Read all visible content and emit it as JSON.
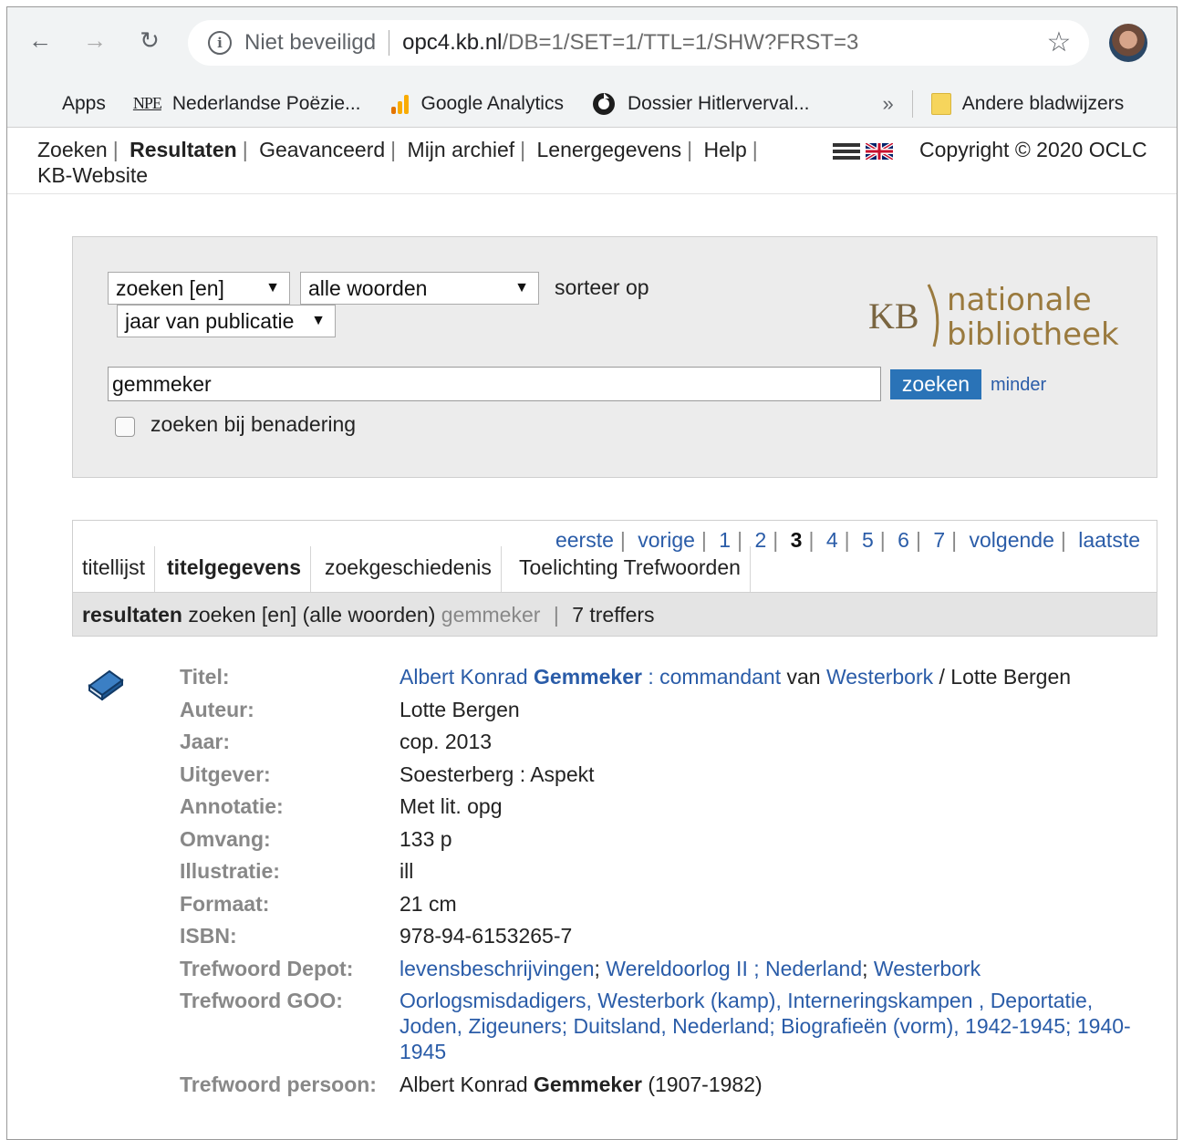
{
  "browser": {
    "security_label": "Niet beveiligd",
    "url_host": "opc4.kb.nl",
    "url_path": "/DB=1/SET=1/TTL=1/SHW?FRST=3",
    "bookmarks": [
      {
        "label": "Apps"
      },
      {
        "label": "Nederlandse Poëzie..."
      },
      {
        "label": "Google Analytics"
      },
      {
        "label": "Dossier Hitlerverval..."
      }
    ],
    "more_bookmarks": "»",
    "other_bookmarks": "Andere bladwijzers"
  },
  "topnav": {
    "items": [
      "Zoeken",
      "Resultaten",
      "Geavanceerd",
      "Mijn archief",
      "Lenergegevens",
      "Help",
      "KB-Website"
    ],
    "copyright": "Copyright © 2020 OCLC"
  },
  "search": {
    "field_select": "zoeken [en]",
    "mode_select": "alle woorden",
    "sort_label": "sorteer op",
    "sort_select": "jaar van publicatie",
    "query": "gemmeker",
    "submit_label": "zoeken",
    "less_label": "minder",
    "approx_label": "zoeken bij benadering",
    "logo": {
      "mark": "KB",
      "line1": "nationale",
      "line2": "bibliotheek"
    }
  },
  "tabs": {
    "items": [
      "titellijst",
      "titelgegevens",
      "zoekgeschiedenis",
      "Toelichting Trefwoorden"
    ],
    "active": "titelgegevens"
  },
  "pager": {
    "first": "eerste",
    "prev": "vorige",
    "pages": [
      "1",
      "2",
      "3",
      "4",
      "5",
      "6",
      "7"
    ],
    "current": "3",
    "next": "volgende",
    "last": "laatste"
  },
  "resultbar": {
    "label": "resultaten",
    "field": "zoeken [en]",
    "mode": "(alle woorden)",
    "query": "gemmeker",
    "count": "7 treffers"
  },
  "record": {
    "labels": {
      "title": "Titel:",
      "author": "Auteur:",
      "year": "Jaar:",
      "publisher": "Uitgever:",
      "annotation": "Annotatie:",
      "extent": "Omvang:",
      "illustration": "Illustratie:",
      "format": "Formaat:",
      "isbn": "ISBN:",
      "kw_depot": "Trefwoord Depot:",
      "kw_goo": "Trefwoord GOO:",
      "kw_person": "Trefwoord persoon:"
    },
    "title": {
      "part1": "Albert Konrad ",
      "part2": "Gemmeker",
      "part3": " : ",
      "part4": "commandant",
      "part5": " van ",
      "part6": "Westerbork",
      "part7": " / Lotte Bergen"
    },
    "author": "Lotte Bergen",
    "year": "cop. 2013",
    "publisher": "Soesterberg : Aspekt",
    "annotation": "Met lit. opg",
    "extent": "133 p",
    "illustration": "ill",
    "format": "21 cm",
    "isbn": "978-94-6153265-7",
    "kw_depot": [
      "levensbeschrijvingen",
      "Wereldoorlog II ; Nederland",
      "Westerbork"
    ],
    "kw_goo": [
      "Oorlogsmisdadigers, Westerbork (kamp)",
      "Interneringskampen",
      "Deportatie, Joden, Zigeuners",
      "Duitsland, Nederland",
      "Biografieën (vorm), 1942-1945",
      "1940-1945"
    ],
    "kw_person": {
      "part1": "Albert Konrad ",
      "part2": "Gemmeker",
      "part3": " (1907-1982)"
    }
  },
  "colors": {
    "link": "#2a5ca8",
    "button": "#2a73b7",
    "panel": "#ececec",
    "label": "#888888"
  }
}
